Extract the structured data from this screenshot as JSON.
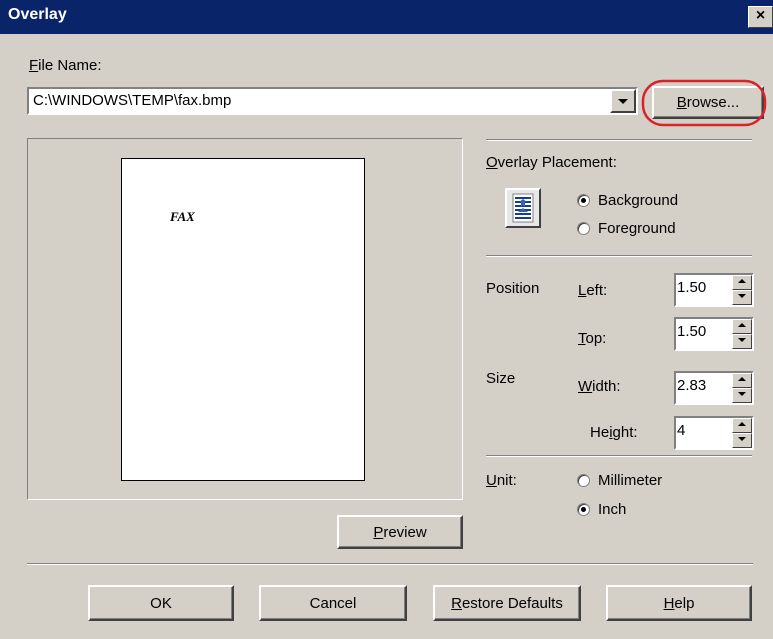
{
  "window": {
    "title": "Overlay",
    "close_label": "×"
  },
  "file": {
    "label": "File Name:",
    "value": "C:\\WINDOWS\\TEMP\\fax.bmp",
    "browse_label": "Browse..."
  },
  "preview_page": {
    "text": "FAX"
  },
  "preview_button": {
    "label": "Preview"
  },
  "placement": {
    "label": "Overlay Placement:",
    "options": [
      "Background",
      "Foreground"
    ],
    "selected": "Background"
  },
  "position": {
    "label": "Position",
    "left_label": "Left:",
    "left_value": "1.50",
    "top_label": "Top:",
    "top_value": "1.50"
  },
  "size": {
    "label": "Size",
    "width_label": "Width:",
    "width_value": "2.83",
    "height_label": "Height:",
    "height_value": "4"
  },
  "unit": {
    "label": "Unit:",
    "options": [
      "Millimeter",
      "Inch"
    ],
    "selected": "Inch"
  },
  "buttons": {
    "ok": "OK",
    "cancel": "Cancel",
    "restore": "Restore Defaults",
    "help": "Help"
  },
  "colors": {
    "titlebar": "#0a246a",
    "dialog_bg": "#d4d0c8",
    "highlight_circle": "#d8232a"
  },
  "icons": {
    "placement": "layers-icon",
    "dropdown": "chevron-down-icon",
    "close": "close-icon"
  }
}
